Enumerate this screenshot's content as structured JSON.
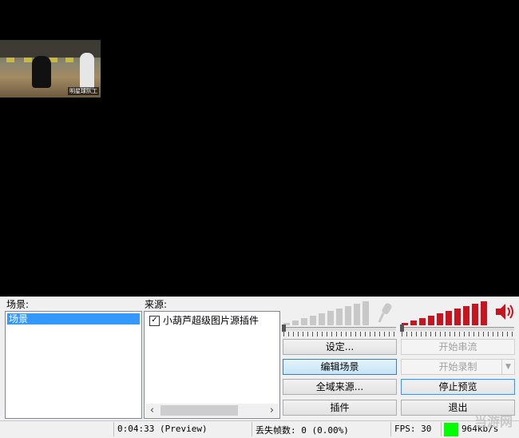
{
  "scenes": {
    "label": "场景:",
    "items": [
      "场景"
    ]
  },
  "sources": {
    "label": "来源:",
    "items": [
      {
        "name": "小葫芦超级图片源插件",
        "checked": true
      }
    ]
  },
  "buttons": {
    "settings": "设定...",
    "edit_scene": "编辑场景",
    "global_sources": "全域来源...",
    "plugins": "插件",
    "start_stream": "开始串流",
    "start_record": "开始录制",
    "stop_preview": "停止预览",
    "exit": "退出"
  },
  "preview": {
    "caption": "明星球队工"
  },
  "status": {
    "time": "0:04:33 (Preview)",
    "dropped": "丢失帧数: 0 (0.00%)",
    "fps": "FPS: 30",
    "bitrate": "964kb/s"
  },
  "watermark": "当游网",
  "colors": {
    "mic_bars": "#c8c8c8",
    "speaker_bars": "#c8141e",
    "selection": "#3399ff",
    "bitrate_ok": "#00ff00"
  },
  "icons": {
    "mic": "microphone-icon",
    "speaker": "speaker-icon"
  }
}
